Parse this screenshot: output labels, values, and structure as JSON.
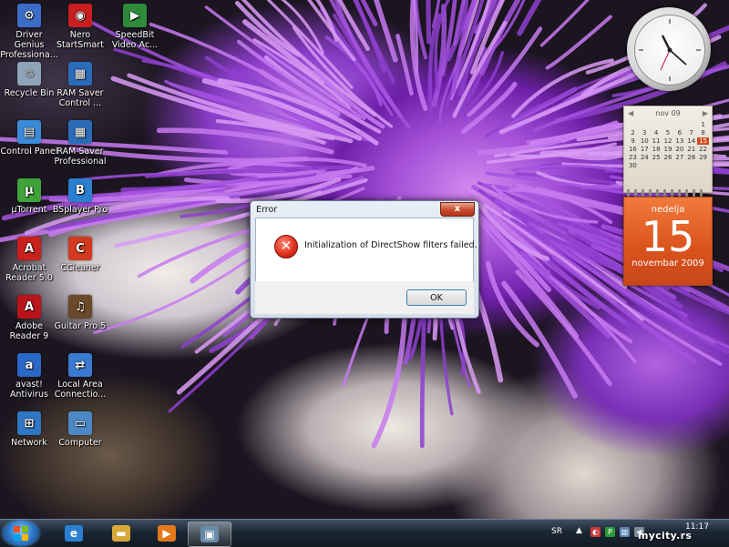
{
  "desktop": {
    "icons": [
      {
        "label": "Driver Genius Professiona...",
        "icon": "driver-genius-icon",
        "color": "#3b6cc8",
        "glyph": "⚙"
      },
      {
        "label": "Nero StartSmart",
        "icon": "nero-icon",
        "color": "#c81e1e",
        "glyph": "◉"
      },
      {
        "label": "SpeedBit Video Ac...",
        "icon": "speedbit-icon",
        "color": "#2e8b3a",
        "glyph": "▶"
      },
      {
        "label": "Recycle Bin",
        "icon": "recycle-bin-icon",
        "color": "#8fa4b8",
        "glyph": "♲"
      },
      {
        "label": "RAM Saver Control ...",
        "icon": "ram-saver-control-icon",
        "color": "#2a6cb8",
        "glyph": "▦"
      },
      {
        "label": "Control Panel",
        "icon": "control-panel-icon",
        "color": "#3a8ad8",
        "glyph": "▤"
      },
      {
        "label": "RAM Saver Professional",
        "icon": "ram-saver-professional-icon",
        "color": "#2a6cb8",
        "glyph": "▦"
      },
      {
        "label": "µTorrent",
        "icon": "utorrent-icon",
        "color": "#3fa33a",
        "glyph": "µ"
      },
      {
        "label": "BSplayer Pro",
        "icon": "bsplayer-icon",
        "color": "#2b7fd0",
        "glyph": "B"
      },
      {
        "label": "Acrobat Reader 5.0",
        "icon": "acrobat-icon",
        "color": "#c8201c",
        "glyph": "A"
      },
      {
        "label": "CCleaner",
        "icon": "ccleaner-icon",
        "color": "#d23a1f",
        "glyph": "C"
      },
      {
        "label": "Adobe Reader 9",
        "icon": "adobe-reader-icon",
        "color": "#b8141a",
        "glyph": "A"
      },
      {
        "label": "Guitar Pro 5",
        "icon": "guitar-pro-icon",
        "color": "#6a4a2a",
        "glyph": "♫"
      },
      {
        "label": "avast! Antivirus",
        "icon": "avast-icon",
        "color": "#2a68c8",
        "glyph": "a"
      },
      {
        "label": "Local Area Connectio...",
        "icon": "network-connection-icon",
        "color": "#3a7ad0",
        "glyph": "⇄"
      },
      {
        "label": "Network",
        "icon": "network-icon",
        "color": "#2f76c4",
        "glyph": "⊞"
      },
      {
        "label": "Computer",
        "icon": "computer-icon",
        "color": "#4d88c6",
        "glyph": "▭"
      }
    ]
  },
  "calendar_gadget": {
    "month_label": "nov 09",
    "days": [
      "",
      "",
      "",
      "",
      "",
      "",
      "1",
      "2",
      "3",
      "4",
      "5",
      "6",
      "7",
      "8",
      "9",
      "10",
      "11",
      "12",
      "13",
      "14",
      "15",
      "16",
      "17",
      "18",
      "19",
      "20",
      "21",
      "22",
      "23",
      "24",
      "25",
      "26",
      "27",
      "28",
      "29",
      "30",
      "",
      "",
      "",
      "",
      "",
      ""
    ],
    "today": "15",
    "day_name": "nedelja",
    "day_number": "15",
    "month_year": "novembar 2009"
  },
  "dialog": {
    "title": "Error",
    "close_glyph": "x",
    "message": "Initialization of DirectShow filters failed.",
    "ok_label": "OK",
    "error_glyph": "✕"
  },
  "taskbar": {
    "apps": [
      {
        "name": "internet-explorer-icon",
        "glyph": "e",
        "color": "#2b7fd0",
        "active": false
      },
      {
        "name": "windows-explorer-icon",
        "glyph": "▬",
        "color": "#d8a83a",
        "active": false
      },
      {
        "name": "media-player-icon",
        "glyph": "▶",
        "color": "#e07a1a",
        "active": false
      },
      {
        "name": "tv-app-icon",
        "glyph": "▣",
        "color": "#6a8aa8",
        "active": true
      }
    ],
    "language": "SR",
    "tray_arrow": "▲",
    "tray_icons": [
      {
        "name": "security-shield-icon",
        "glyph": "◐",
        "color": "#c83a3a"
      },
      {
        "name": "green-app-icon",
        "glyph": "P",
        "color": "#2c9a3a"
      },
      {
        "name": "network-tray-icon",
        "glyph": "▥",
        "color": "#5b86b5"
      },
      {
        "name": "volume-icon",
        "glyph": "◀",
        "color": "#7a8a9a"
      }
    ],
    "time": "11:17"
  },
  "watermark": "mycity.rs"
}
